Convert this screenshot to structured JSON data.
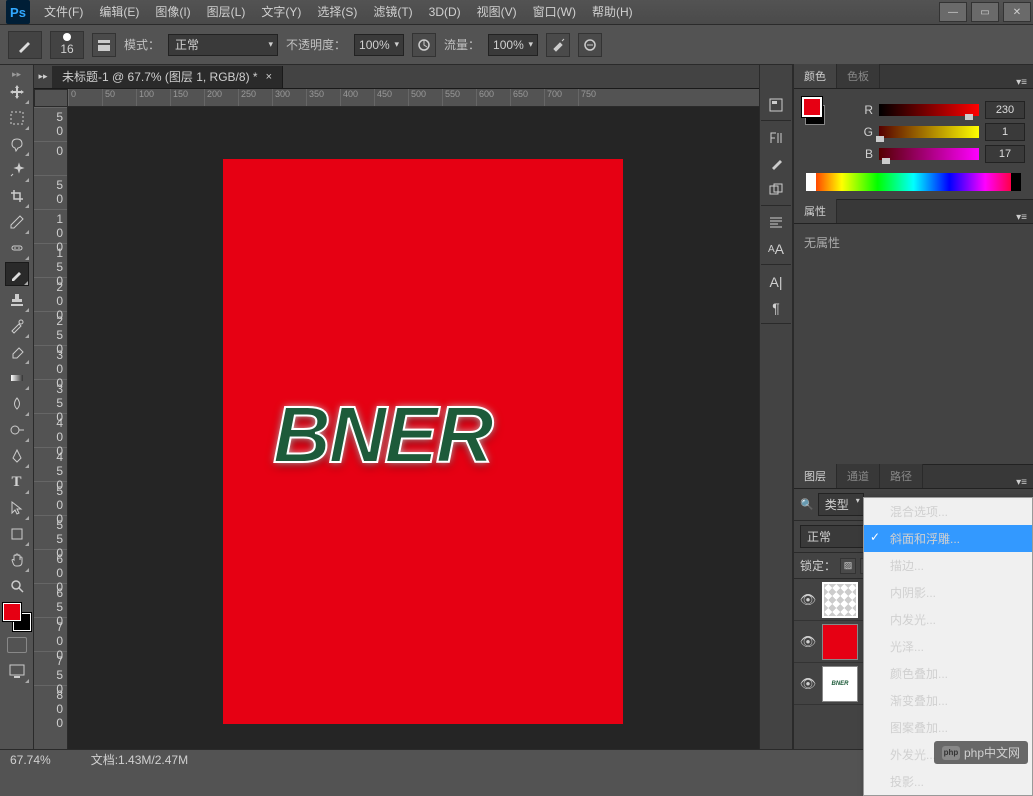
{
  "app": {
    "logo_text": "Ps"
  },
  "menu": [
    "文件(F)",
    "编辑(E)",
    "图像(I)",
    "图层(L)",
    "文字(Y)",
    "选择(S)",
    "滤镜(T)",
    "3D(D)",
    "视图(V)",
    "窗口(W)",
    "帮助(H)"
  ],
  "options": {
    "brush_size": "16",
    "mode_label": "模式：",
    "mode_value": "正常",
    "opacity_label": "不透明度：",
    "opacity_value": "100%",
    "flow_label": "流量：",
    "flow_value": "100%"
  },
  "document": {
    "tab_title": "未标题-1 @ 67.7% (图层 1, RGB/8) *",
    "canvas_text": "BNER"
  },
  "ruler_h": [
    "0",
    "50",
    "100",
    "150",
    "200",
    "250",
    "300",
    "350",
    "400",
    "450",
    "500",
    "550",
    "600",
    "650",
    "700",
    "750"
  ],
  "ruler_v": [
    "50",
    "0",
    "50",
    "100",
    "150",
    "200",
    "250",
    "300",
    "350",
    "400",
    "450",
    "500",
    "550",
    "600",
    "650",
    "700",
    "750",
    "800"
  ],
  "color_panel": {
    "tab_color": "颜色",
    "tab_swatch": "色板",
    "r_label": "R",
    "r_value": "230",
    "g_label": "G",
    "g_value": "1",
    "b_label": "B",
    "b_value": "17"
  },
  "props_panel": {
    "tab": "属性",
    "body": "无属性"
  },
  "layers_panel": {
    "tab_layers": "图层",
    "tab_channels": "通道",
    "tab_paths": "路径",
    "filter_label": "类型",
    "blend_value": "正常",
    "lock_label": "锁定："
  },
  "context_menu": {
    "items": [
      "混合选项...",
      "斜面和浮雕...",
      "描边...",
      "内阴影...",
      "内发光...",
      "光泽...",
      "颜色叠加...",
      "渐变叠加...",
      "图案叠加...",
      "外发光...",
      "投影..."
    ],
    "checked_index": 1,
    "highlighted_index": 1
  },
  "status": {
    "zoom": "67.74%",
    "doc_info": "文档:1.43M/2.47M"
  },
  "watermark": {
    "prefix": "php",
    "text": "php中文网"
  }
}
